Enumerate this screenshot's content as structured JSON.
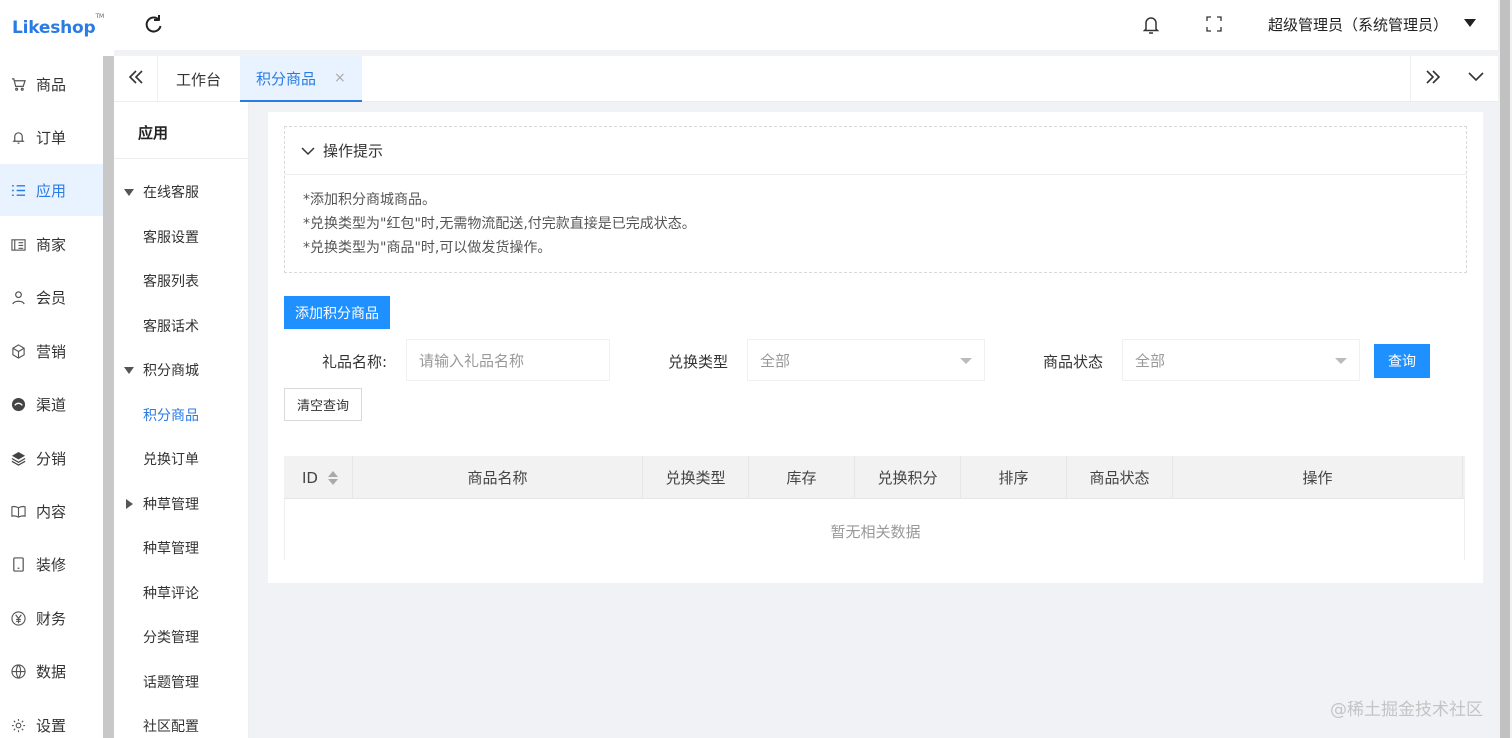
{
  "logo": {
    "text": "Likeshop",
    "tm": "TM"
  },
  "sidebar": {
    "items": [
      {
        "label": "商品",
        "icon": "cart-icon"
      },
      {
        "label": "订单",
        "icon": "bell-icon"
      },
      {
        "label": "应用",
        "icon": "list-icon",
        "active": true
      },
      {
        "label": "商家",
        "icon": "store-icon"
      },
      {
        "label": "会员",
        "icon": "user-icon"
      },
      {
        "label": "营销",
        "icon": "cube-icon"
      },
      {
        "label": "渠道",
        "icon": "channel-icon"
      },
      {
        "label": "分销",
        "icon": "layers-icon"
      },
      {
        "label": "内容",
        "icon": "book-icon"
      },
      {
        "label": "装修",
        "icon": "tablet-icon"
      },
      {
        "label": "财务",
        "icon": "yen-icon"
      },
      {
        "label": "数据",
        "icon": "globe-icon"
      },
      {
        "label": "设置",
        "icon": "gear-icon"
      }
    ]
  },
  "header": {
    "user": "超级管理员（系统管理员）"
  },
  "tabs": {
    "items": [
      {
        "label": "工作台"
      },
      {
        "label": "积分商品",
        "active": true,
        "close": "×"
      }
    ]
  },
  "submenu": {
    "title": "应用",
    "groups": {
      "online_service": "在线客服",
      "points_mall": "积分商城",
      "grass": "种草管理"
    },
    "items": {
      "service_settings": "客服设置",
      "service_list": "客服列表",
      "service_scripts": "客服话术",
      "points_goods": "积分商品",
      "exchange_orders": "兑换订单",
      "grass_manage": "种草管理",
      "grass_comments": "种草评论",
      "category_manage": "分类管理",
      "topic_manage": "话题管理",
      "community_config": "社区配置"
    }
  },
  "tips": {
    "header": "操作提示",
    "lines": [
      "*添加积分商城商品。",
      "*兑换类型为\"红包\"时,无需物流配送,付完款直接是已完成状态。",
      "*兑换类型为\"商品\"时,可以做发货操作。"
    ]
  },
  "toolbar": {
    "add_label": "添加积分商品"
  },
  "filters": {
    "name_label": "礼品名称:",
    "name_placeholder": "请输入礼品名称",
    "type_label": "兑换类型",
    "type_value": "全部",
    "status_label": "商品状态",
    "status_value": "全部",
    "query_label": "查询",
    "reset_label": "清空查询"
  },
  "table": {
    "columns": [
      "ID",
      "商品名称",
      "兑换类型",
      "库存",
      "兑换积分",
      "排序",
      "商品状态",
      "操作"
    ],
    "empty_text": "暂无相关数据"
  },
  "watermark": "@稀土掘金技术社区",
  "colors": {
    "accent": "#2a7be4",
    "primary_button": "#1e90ff"
  }
}
